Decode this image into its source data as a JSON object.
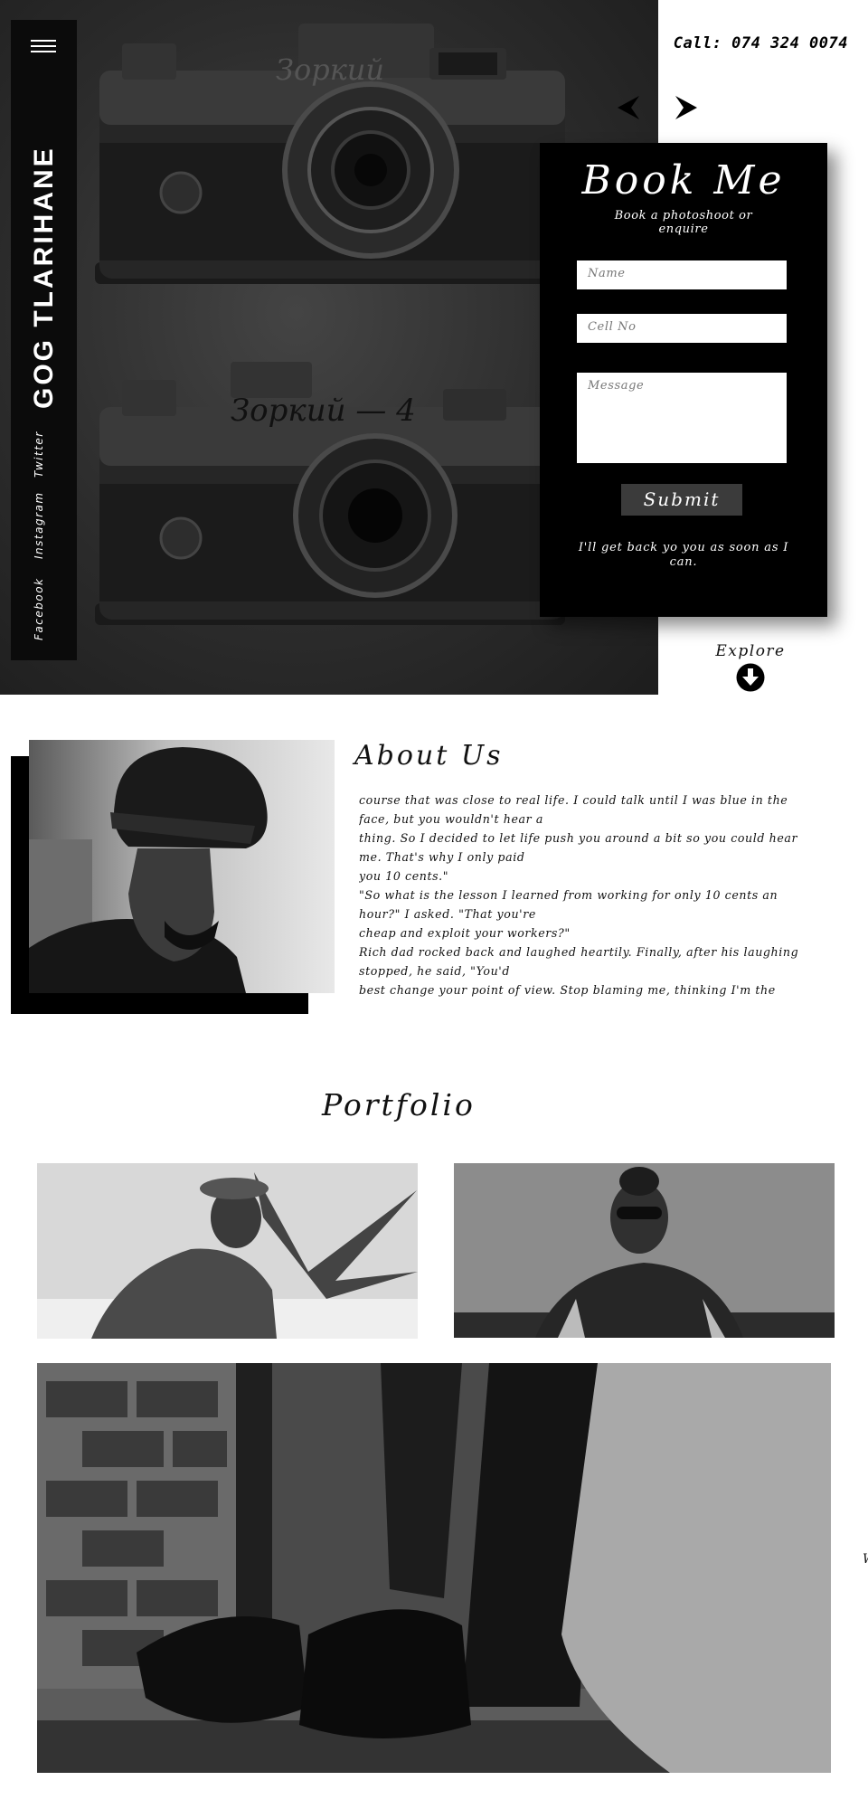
{
  "brand": {
    "name": "GOG TLARIHANE"
  },
  "nav": {
    "menu_icon": "hamburger-icon"
  },
  "social": [
    {
      "label": "Twitter"
    },
    {
      "label": "Instagram"
    },
    {
      "label": "Facebook"
    }
  ],
  "header": {
    "phone": "Call: 074 324 0074"
  },
  "carousel": {
    "prev_icon": "chevron-left-icon",
    "next_icon": "chevron-right-icon"
  },
  "booking": {
    "title": "Book Me",
    "subtitle": "Book a photoshoot or enquire",
    "name_placeholder": "Name",
    "cell_placeholder": "Cell No",
    "message_placeholder": "Message",
    "submit_label": "Submit",
    "reply_note": "I'll get back yo you as soon as I can."
  },
  "explore": {
    "label": "Explore",
    "icon": "arrow-down-circle-icon"
  },
  "about": {
    "title": "About Us",
    "lines": [
      "course that was close to real life. I could talk until I was blue in the",
      "face, but you wouldn't hear a",
      "thing. So I decided to let life push you around a bit so you could hear",
      "me. That's why I only paid",
      "you 10 cents.\"",
      "\"So what is the lesson I learned from working for only 10 cents an",
      "hour?\" I asked. \"That you're",
      "cheap and exploit your workers?\"",
      "Rich dad rocked back and laughed heartily. Finally, after his laughing",
      "stopped, he said, \"You'd",
      "best change your point of view. Stop blaming me, thinking I'm the"
    ]
  },
  "portfolio": {
    "title": "Portfolio",
    "edge_text": "W"
  },
  "colors": {
    "background": "#ffffff",
    "panel": "#000000",
    "accent_gray": "#3b3b3b"
  }
}
